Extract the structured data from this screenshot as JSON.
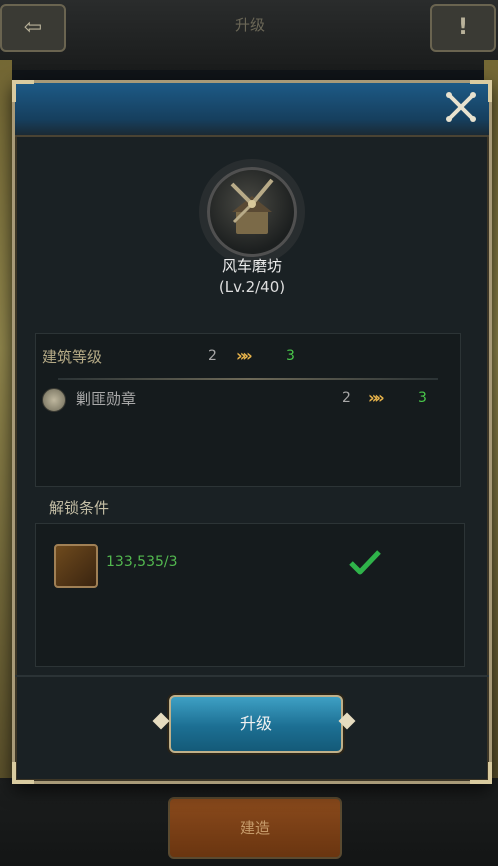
{
  "background": {
    "back_icon": "⇦",
    "title": "升级",
    "info_icon": "!",
    "action_label": "建造"
  },
  "modal": {
    "close_icon": "close-icon",
    "building": {
      "name": "风车磨坊",
      "level": "(Lv.2/40)"
    },
    "details": {
      "rows": [
        {
          "label": "建筑等级",
          "from": "2",
          "arrows": "»»",
          "to": "3"
        },
        {
          "label": "剿匪勋章",
          "from": "2",
          "arrows": "»»",
          "to": "3"
        }
      ]
    },
    "unlock": {
      "title": "解锁条件",
      "requirement_value": "133,535/3",
      "status": "satisfied"
    },
    "upgrade_button": "升级"
  },
  "colors": {
    "accent_green": "#49c74a",
    "arrow_gold": "#e6b24a",
    "header_blue": "#1d5a86"
  }
}
